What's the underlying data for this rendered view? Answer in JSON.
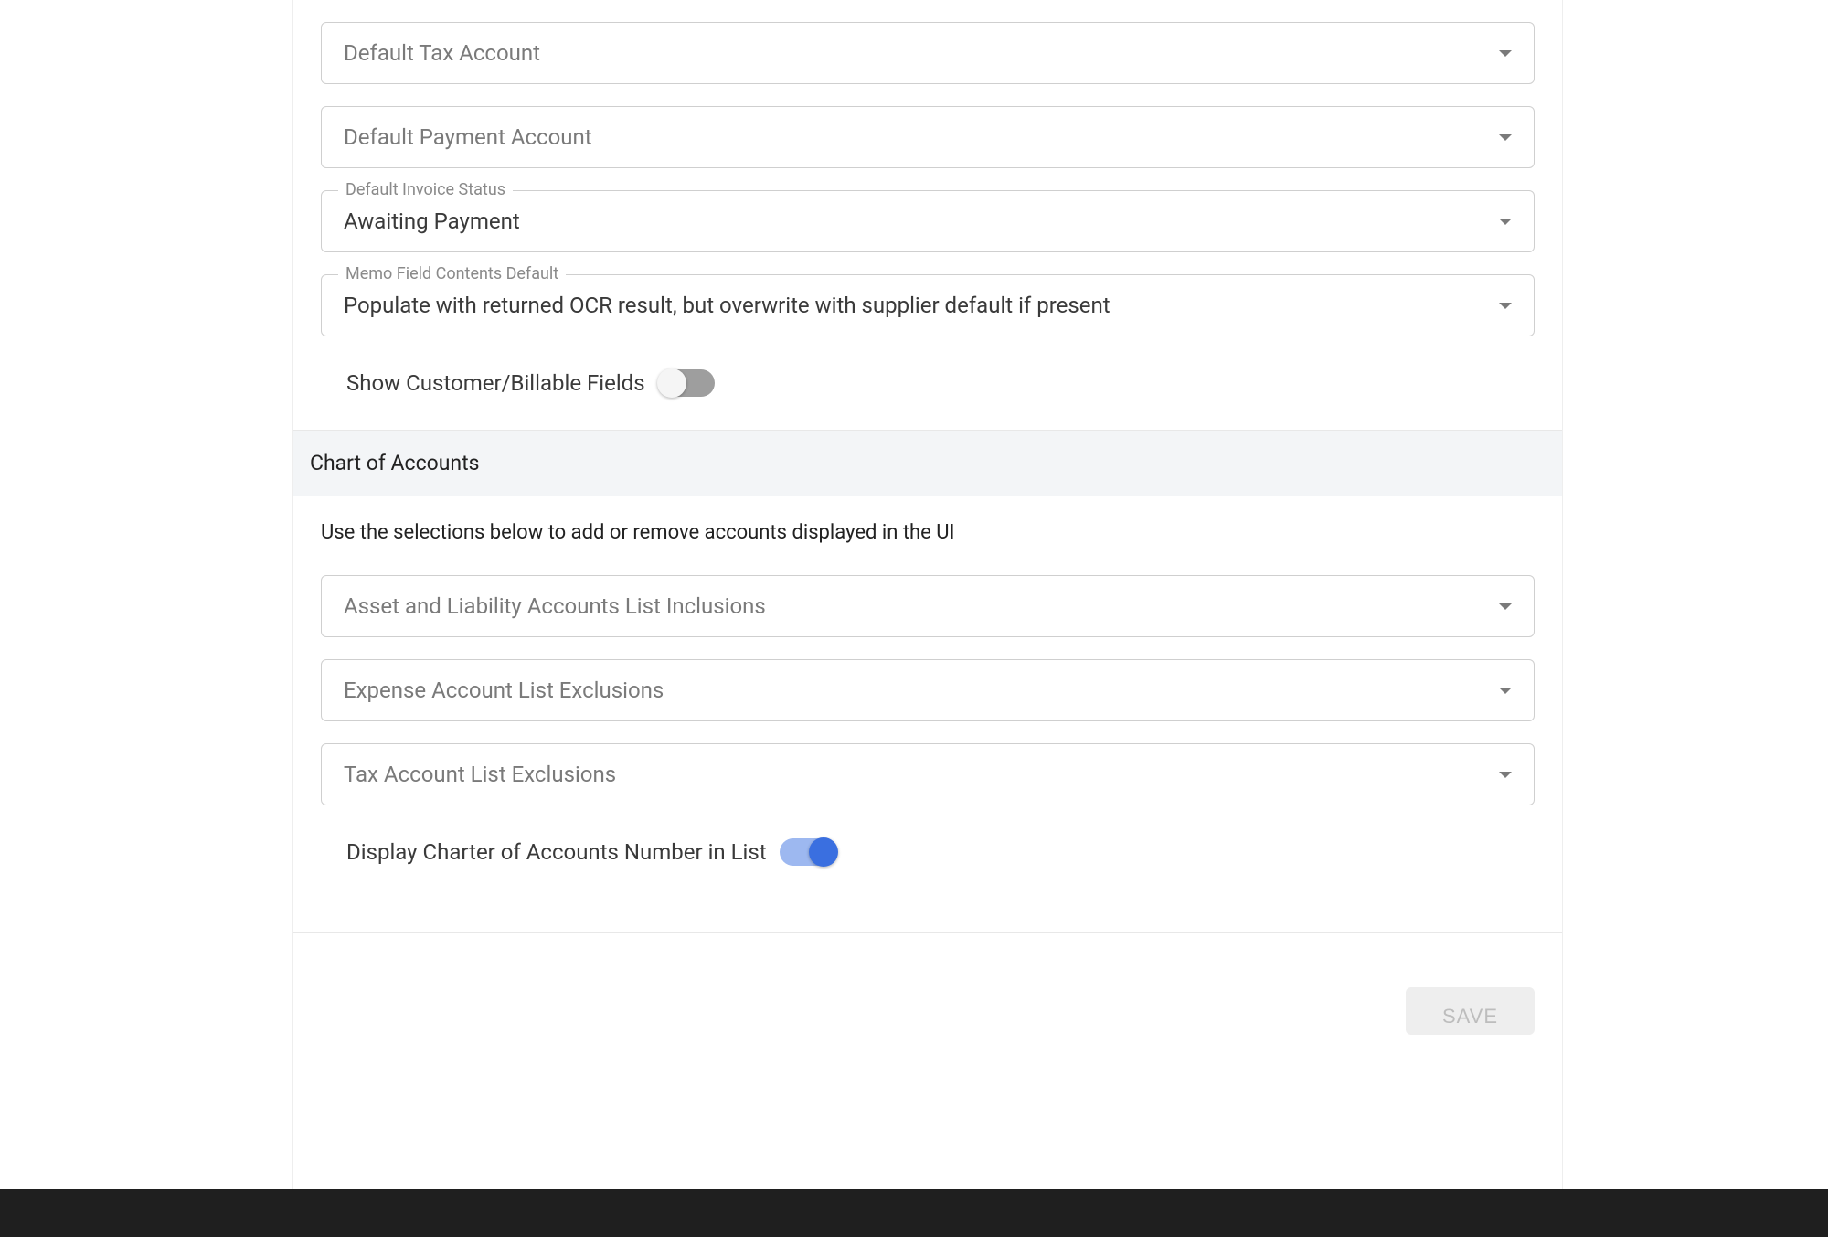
{
  "fields": {
    "default_tax_account": {
      "placeholder": "Default Tax Account",
      "value": ""
    },
    "default_payment_account": {
      "placeholder": "Default Payment Account",
      "value": ""
    },
    "default_invoice_status": {
      "label": "Default Invoice Status",
      "value": "Awaiting Payment"
    },
    "memo_field_contents_default": {
      "label": "Memo Field Contents Default",
      "value": "Populate with returned OCR result, but overwrite with supplier default if present"
    }
  },
  "toggles": {
    "show_customer_billable": {
      "label": "Show Customer/Billable Fields",
      "on": false
    },
    "display_charter_number": {
      "label": "Display Charter of Accounts Number in List",
      "on": true
    }
  },
  "chart_of_accounts": {
    "header": "Chart of Accounts",
    "description": "Use the selections below to add or remove accounts displayed in the UI",
    "asset_liability_inclusions": {
      "placeholder": "Asset and Liability Accounts List Inclusions"
    },
    "expense_exclusions": {
      "placeholder": "Expense Account List Exclusions"
    },
    "tax_exclusions": {
      "placeholder": "Tax Account List Exclusions"
    }
  },
  "actions": {
    "save_label": "SAVE"
  }
}
